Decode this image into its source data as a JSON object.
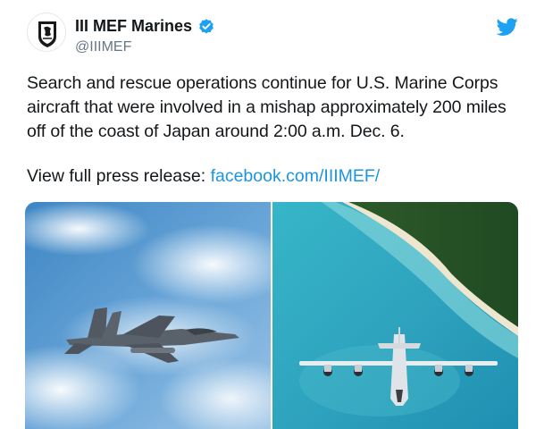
{
  "tweet": {
    "author_name": "III MEF Marines",
    "handle": "@IIIMEF",
    "body": "Search and rescue operations continue for U.S. Marine Corps aircraft that were involved in a mishap approximately 200 miles off of the coast of Japan around 2:00 a.m. Dec. 6.",
    "press_prefix": "View full press release: ",
    "press_link": "facebook.com/IIIMEF/",
    "verified": true
  },
  "icons": {
    "avatar": "marine-corps-emblem-icon",
    "verified": "verified-badge-icon",
    "bird": "twitter-bird-icon"
  },
  "media": {
    "photos": [
      {
        "name": "fa18-hornet-photo"
      },
      {
        "name": "kc130-over-coast-photo"
      }
    ]
  },
  "colors": {
    "link": "#1b95e0",
    "verified": "#1da1f2",
    "handle": "#657786",
    "text": "#14171a"
  }
}
